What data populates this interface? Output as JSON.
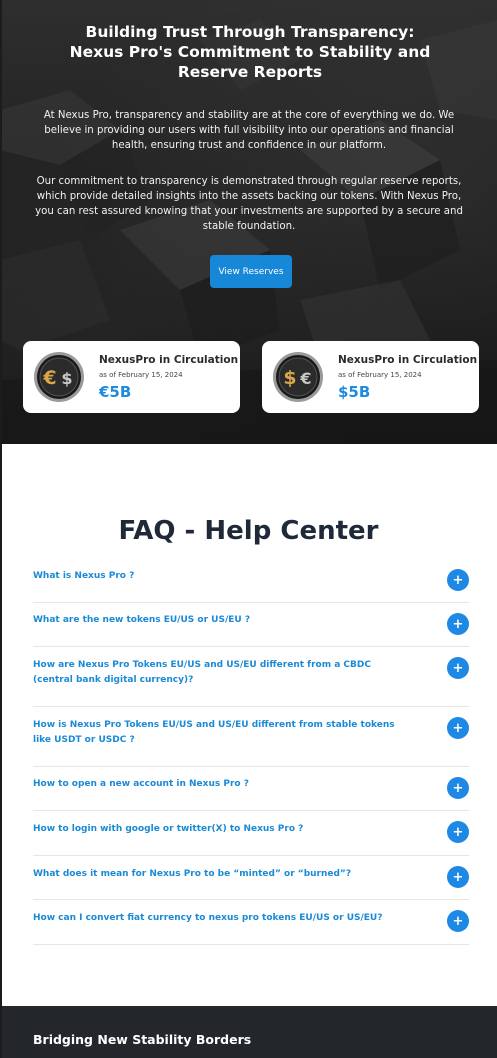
{
  "hero": {
    "title_lines": [
      "Building Trust Through Transparency:",
      "Nexus Pro's Commitment to Stability and",
      "Reserve Reports"
    ],
    "paragraph1": "At Nexus Pro, transparency and stability are at the core of everything we do. We believe in providing our users with full visibility into our operations and financial health, ensuring trust and confidence in our platform.",
    "paragraph2": "Our commitment to transparency is demonstrated through regular reserve reports, which provide detailed insights into the assets backing our tokens. With Nexus Pro, you can rest assured knowing that your investments are supported by a secure and stable foundation.",
    "button_label": "View Reserves"
  },
  "cards": [
    {
      "title": "NexusPro in Circulation",
      "date": "as of February 15, 2024",
      "value": "€5B",
      "icon": "euro-dollar-coin-icon",
      "coin_left": "€",
      "coin_right": "$"
    },
    {
      "title": "NexusPro in Circulation",
      "date": "as of February 15, 2024",
      "value": "$5B",
      "icon": "dollar-euro-coin-icon",
      "coin_left": "$",
      "coin_right": "€"
    }
  ],
  "faq": {
    "title": "FAQ - Help Center",
    "items": [
      {
        "question": "What is Nexus Pro ?"
      },
      {
        "question": "What are the new tokens EU/US or US/EU ?"
      },
      {
        "question": "How are Nexus Pro Tokens EU/US and US/EU different from a CBDC (central bank digital currency)?"
      },
      {
        "question": "How is Nexus Pro Tokens EU/US and US/EU different from stable tokens like USDT or USDC ?"
      },
      {
        "question": "How to open a new account in Nexus Pro ?"
      },
      {
        "question": "How to login with google or twitter(X) to Nexus Pro ?"
      },
      {
        "question": "What does it mean for Nexus Pro to be “minted” or “burned”?"
      },
      {
        "question": "How can I convert fiat currency to nexus pro tokens EU/US or US/EU?"
      }
    ],
    "expand_symbol": "+"
  },
  "footer": {
    "title": "Bridging New Stability Borders"
  },
  "colors": {
    "accent": "#1e88e5",
    "link": "#1b8ad6",
    "dark": "#23272b",
    "gold": "#d9a74a"
  }
}
